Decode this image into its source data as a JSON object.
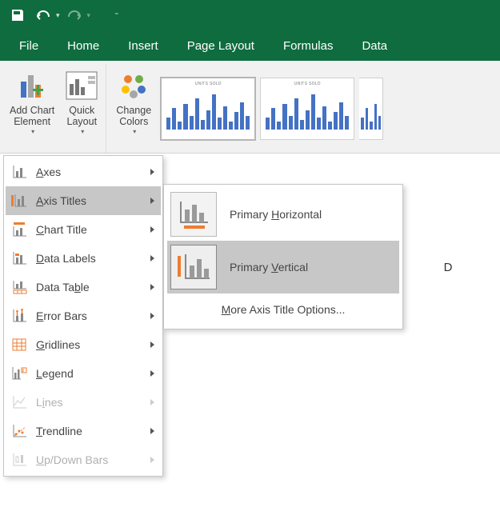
{
  "menubar": {
    "file": "File",
    "home": "Home",
    "insert": "Insert",
    "page_layout": "Page Layout",
    "formulas": "Formulas",
    "data": "Data"
  },
  "ribbon": {
    "add_chart_element": "Add Chart\nElement",
    "quick_layout": "Quick\nLayout",
    "change_colors": "Change\nColors"
  },
  "chart_thumbs": {
    "t1": "UNITS SOLD",
    "t2": "UNITS SOLD"
  },
  "menu1": {
    "axes": "Axes",
    "axis_titles": "Axis Titles",
    "chart_title": "Chart Title",
    "data_labels": "Data Labels",
    "data_table": "Data Table",
    "error_bars": "Error Bars",
    "gridlines": "Gridlines",
    "legend": "Legend",
    "lines": "Lines",
    "trendline": "Trendline",
    "updown": "Up/Down Bars"
  },
  "menu2": {
    "primary_h": "Primary Horizontal",
    "primary_v": "Primary Vertical",
    "more": "More Axis Title Options..."
  },
  "sheet": {
    "colD": "D"
  }
}
